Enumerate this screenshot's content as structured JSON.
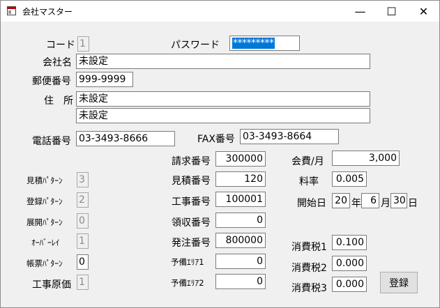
{
  "window": {
    "title": "会社マスター",
    "minimize": "—",
    "maximize": "☐",
    "close": "✕"
  },
  "labels": {
    "code": "コード",
    "password": "パスワード",
    "company_name": "会社名",
    "postal_code": "郵便番号",
    "address": "住　所",
    "phone": "電話番号",
    "fax": "FAX番号",
    "billing_no": "請求番号",
    "estimate_no": "見積番号",
    "construction_no": "工事番号",
    "receipt_no": "領収番号",
    "order_no": "発注番号",
    "reserve1": "予備ｴﾘｱ1",
    "reserve2": "予備ｴﾘｱ2",
    "estimate_pattern": "見積ﾊﾟﾀｰﾝ",
    "register_pattern": "登録ﾊﾟﾀｰﾝ",
    "expand_pattern": "展開ﾊﾟﾀｰﾝ",
    "overlay": "ｵｰﾊﾞｰﾚｲ",
    "form_pattern": "帳票ﾊﾟﾀｰﾝ",
    "construction_cost": "工事原価",
    "fee_per_month": "会費/月",
    "rate": "料率",
    "start_date": "開始日",
    "year": "年",
    "month": "月",
    "day": "日",
    "tax1": "消費税1",
    "tax2": "消費税2",
    "tax3": "消費税3"
  },
  "values": {
    "code": "1",
    "password": "*********",
    "company_name": "未設定",
    "postal_code": "999-9999",
    "address1": "未設定",
    "address2": "未設定",
    "phone": "03-3493-8666",
    "fax": "03-3493-8664",
    "billing_no": "300000",
    "estimate_no": "120",
    "construction_no": "100001",
    "receipt_no": "0",
    "order_no": "800000",
    "reserve1": "0",
    "reserve2": "0",
    "estimate_pattern": "3",
    "register_pattern": "2",
    "expand_pattern": "0",
    "overlay": "1",
    "form_pattern": "0",
    "construction_cost": "1",
    "fee_per_month": "3,000",
    "rate": "0.005",
    "start_year": "20",
    "start_month": "6",
    "start_day": "30",
    "tax1": "0.100",
    "tax2": "0.000",
    "tax3": "0.000"
  },
  "buttons": {
    "register": "登録"
  }
}
